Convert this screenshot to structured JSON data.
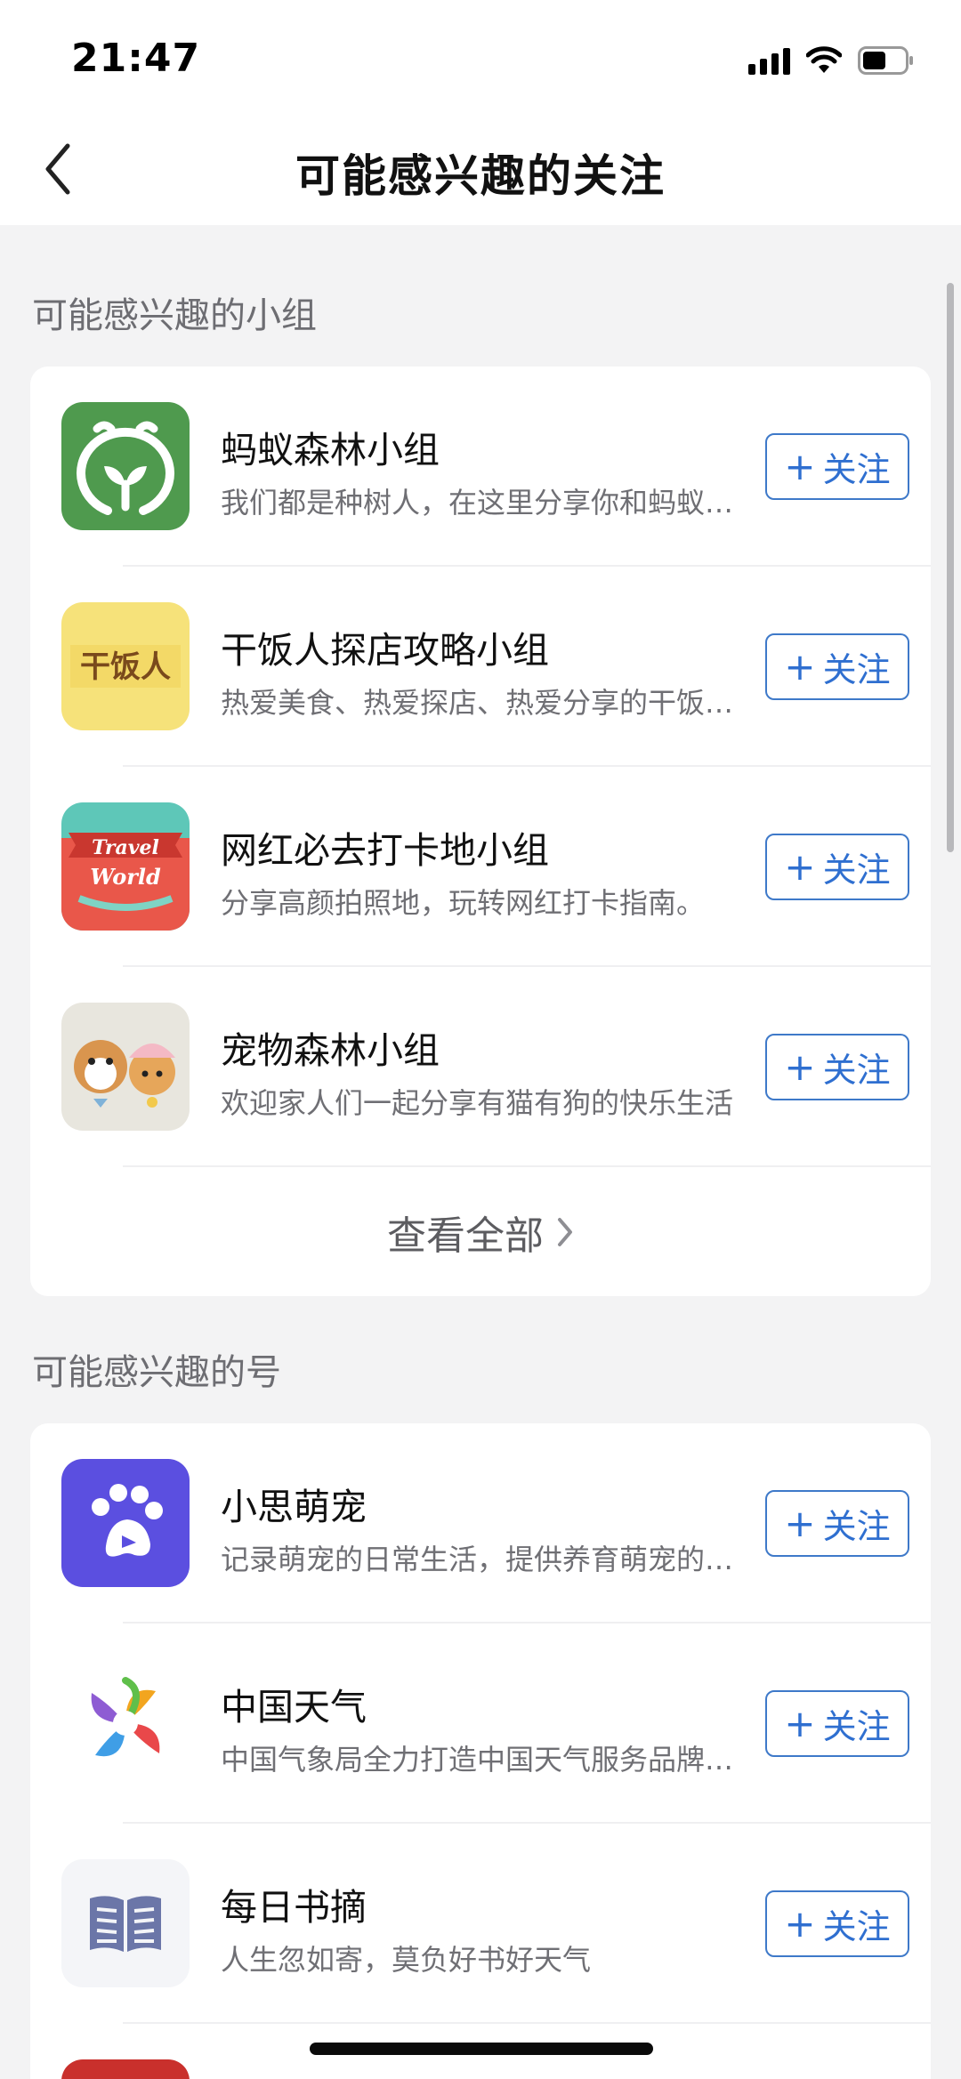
{
  "status": {
    "time": "21:47"
  },
  "nav": {
    "title": "可能感兴趣的关注"
  },
  "groups_section": {
    "title": "可能感兴趣的小组",
    "items": [
      {
        "name": "蚂蚁森林小组",
        "desc": "我们都是种树人，在这里分享你和蚂蚁森林的故事",
        "follow": "关注",
        "icon": "ant-forest-sprout-icon"
      },
      {
        "name": "干饭人探店攻略小组",
        "desc": "热爱美食、热爱探店、热爱分享的干饭人集合地",
        "follow": "关注",
        "icon": "ganfanren-logo",
        "logo_text": "干饭人"
      },
      {
        "name": "网红必去打卡地小组",
        "desc": "分享高颜拍照地，玩转网红打卡指南。",
        "follow": "关注",
        "icon": "travel-world-badge",
        "logo_text_1": "Travel",
        "logo_text_2": "World"
      },
      {
        "name": "宠物森林小组",
        "desc": "欢迎家人们一起分享有猫有狗的快乐生活",
        "follow": "关注",
        "icon": "pet-cartoon-avatar"
      }
    ],
    "view_all": "查看全部"
  },
  "accounts_section": {
    "title": "可能感兴趣的号",
    "items": [
      {
        "name": "小思萌宠",
        "desc": "记录萌宠的日常生活，提供养育萌宠的知识技巧",
        "follow": "关注",
        "icon": "paw-icon"
      },
      {
        "name": "中国天气",
        "desc": "中国气象局全力打造中国天气服务品牌，权威发布",
        "follow": "关注",
        "icon": "pinwheel-icon"
      },
      {
        "name": "每日书摘",
        "desc": "人生忽如寄，莫负好书好天气",
        "follow": "关注",
        "icon": "book-icon"
      }
    ]
  },
  "colors": {
    "accent": "#2f6fd0",
    "background": "#f3f3f4",
    "card": "#ffffff"
  }
}
